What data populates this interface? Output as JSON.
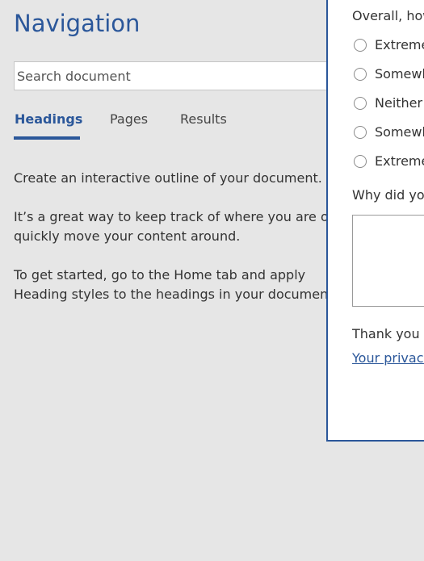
{
  "navigation": {
    "title": "Navigation",
    "search": {
      "placeholder": "Search document",
      "value": ""
    },
    "tabs": [
      {
        "label": "Headings",
        "selected": true
      },
      {
        "label": "Pages",
        "selected": false
      },
      {
        "label": "Results",
        "selected": false
      }
    ],
    "paragraphs": [
      "Create an interactive outline of your document.",
      "It’s a great way to keep track of where you are or quickly move your content around.",
      "To get started, go to the Home tab and apply Heading styles to the headings in your document."
    ]
  },
  "survey": {
    "question": "Overall, how",
    "options": [
      "Extreme",
      "Somewh",
      "Neither",
      "Somewh",
      "Extreme"
    ],
    "why_label": "Why did yo",
    "why_value": "",
    "thanks": "Thank you f",
    "privacy_link": "Your privacy"
  },
  "colors": {
    "accent": "#2b579a",
    "pane_background": "#e6e6e6",
    "panel_background": "#ffffff",
    "text": "#333333"
  }
}
